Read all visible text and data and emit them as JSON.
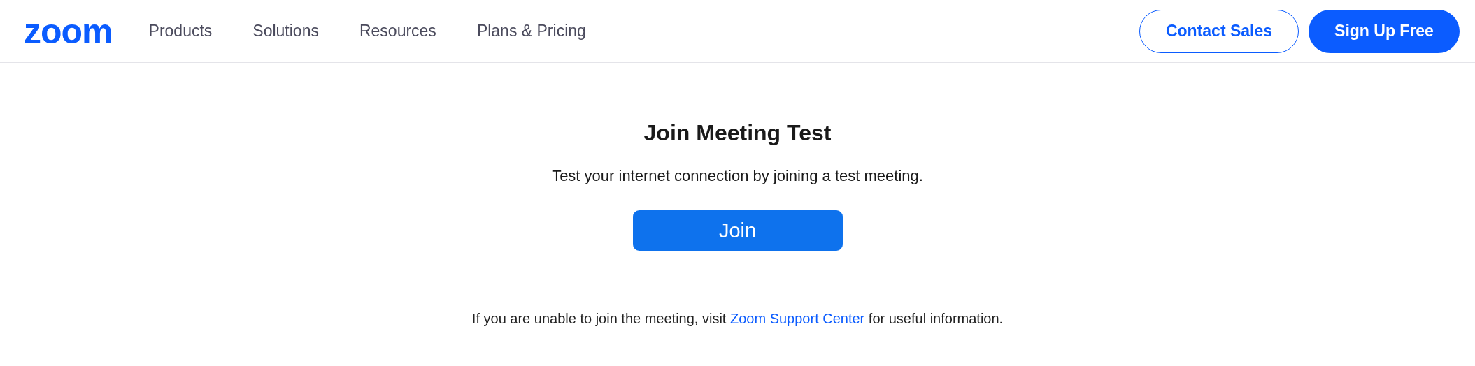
{
  "header": {
    "logo": "zoom",
    "nav": [
      "Products",
      "Solutions",
      "Resources",
      "Plans & Pricing"
    ],
    "buttons": [
      {
        "label": "Contact Sales",
        "kind": "outline"
      },
      {
        "label": "Sign Up Free",
        "kind": "filled"
      }
    ]
  },
  "main": {
    "title": "Join Meeting Test",
    "subtitle": "Test your internet connection by joining a test meeting.",
    "button": "Join"
  },
  "footer": {
    "before": "If you are unable to join the meeting, visit ",
    "link": "Zoom Support Center",
    "after": " for useful information."
  }
}
